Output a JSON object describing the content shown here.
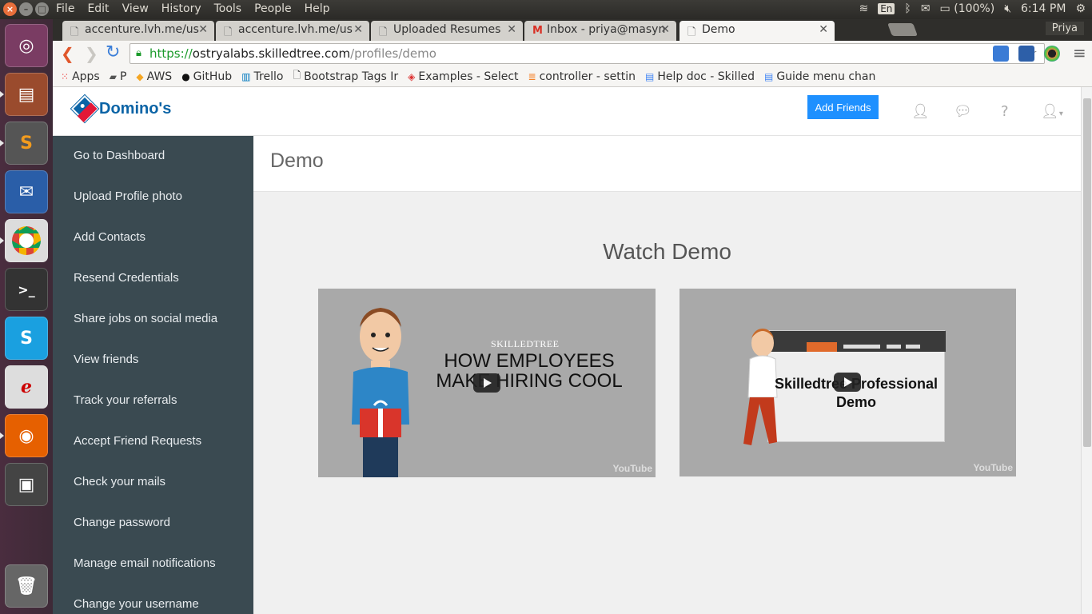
{
  "os": {
    "menu": [
      "File",
      "Edit",
      "View",
      "History",
      "Tools",
      "People",
      "Help"
    ],
    "keyboard_layout": "En",
    "battery": "(100%)",
    "clock": "6:14 PM",
    "user": "Priya"
  },
  "browser": {
    "tabs": [
      {
        "title": "accenture.lvh.me/us",
        "active": false
      },
      {
        "title": "accenture.lvh.me/us",
        "active": false
      },
      {
        "title": "Uploaded Resumes",
        "active": false
      },
      {
        "title": "Inbox - priya@masyn",
        "active": false
      },
      {
        "title": "Demo",
        "active": true
      }
    ],
    "url": {
      "scheme": "https://",
      "host": "ostryalabs.skilledtree.com",
      "path": "/profiles/demo"
    },
    "bookmarks": [
      {
        "label": "Apps",
        "icon": "apps-grid-icon"
      },
      {
        "label": "P",
        "icon": "folder-icon"
      },
      {
        "label": "AWS",
        "icon": "aws-icon"
      },
      {
        "label": "GitHub",
        "icon": "github-icon"
      },
      {
        "label": "Trello",
        "icon": "trello-icon"
      },
      {
        "label": "Bootstrap Tags Ir",
        "icon": "page-icon"
      },
      {
        "label": "Examples - Select",
        "icon": "stack-icon"
      },
      {
        "label": "controller - settin",
        "icon": "stackoverflow-icon"
      },
      {
        "label": "Help doc - Skilled",
        "icon": "doc-icon"
      },
      {
        "label": "Guide menu chan",
        "icon": "doc-icon"
      }
    ]
  },
  "app": {
    "logo_text": "Domino's",
    "add_friends_label": "Add Friends",
    "sidebar": [
      "Go to Dashboard",
      "Upload Profile photo",
      "Add Contacts",
      "Resend Credentials",
      "Share jobs on social media",
      "View friends",
      "Track your referrals",
      "Accept Friend Requests",
      "Check your mails",
      "Change password",
      "Manage email notifications",
      "Change your username"
    ],
    "page_title": "Demo",
    "section_title": "Watch Demo",
    "videos": [
      {
        "brand": "SKILLEDTREE",
        "title": "HOW EMPLOYEES MAKE HIRING COOL",
        "provider": "YouTube"
      },
      {
        "title": "Skilledtree Professional Demo",
        "provider": "YouTube"
      }
    ]
  },
  "colors": {
    "sidebar_bg": "#3a4a51",
    "primary_button": "#1e90ff",
    "brand_blue": "#0b64a6",
    "brand_red": "#e31837"
  }
}
